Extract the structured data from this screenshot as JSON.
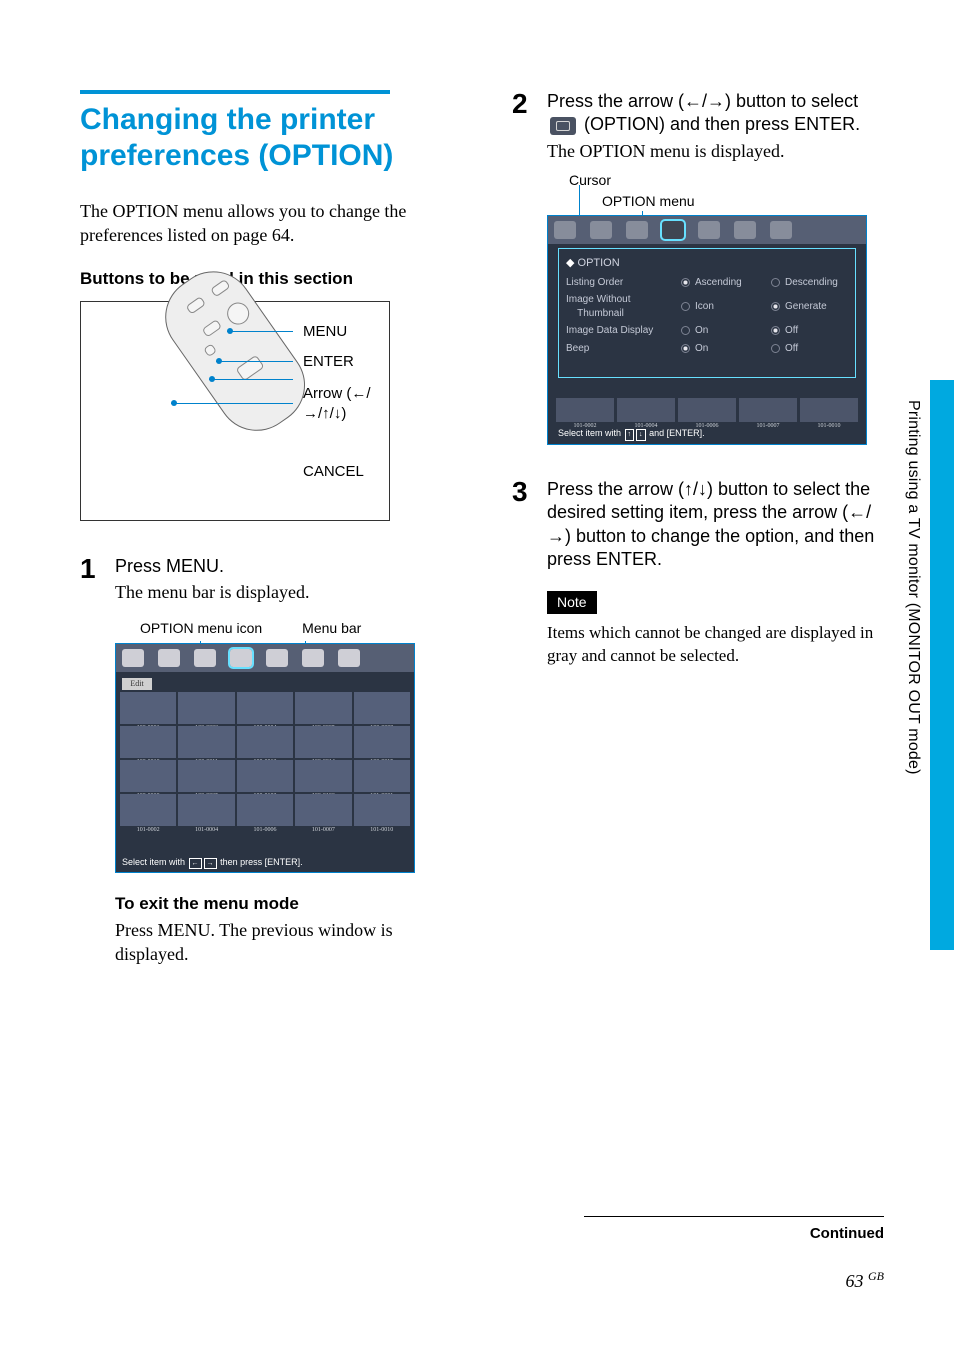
{
  "title": "Changing the printer preferences (OPTION)",
  "intro": "The OPTION menu allows you to change the preferences listed on page 64.",
  "buttons_heading": "Buttons to be used in this section",
  "remote_labels": {
    "menu": "MENU",
    "enter": "ENTER",
    "arrow": "Arrow (←/→/↑/↓)",
    "cancel": "CANCEL"
  },
  "step1": {
    "num": "1",
    "head": "Press MENU.",
    "desc": "The menu bar is displayed.",
    "label_icon": "OPTION menu icon",
    "label_bar": "Menu bar"
  },
  "screen1": {
    "edit": "Edit",
    "ids_row1": [
      "100-0001",
      "100-0003",
      "100-0004",
      "100-0005",
      "100-0008"
    ],
    "ids_row2": [
      "100-0010",
      "100-0011",
      "100-0012",
      "100-0014",
      "100-0015"
    ],
    "ids_row3": [
      "100-0030",
      "100-0035",
      "100-0102",
      "100-0103",
      "101-0001"
    ],
    "ids_row4": [
      "101-0002",
      "101-0004",
      "101-0006",
      "101-0007",
      "101-0010"
    ],
    "footer_a": "Select item with",
    "footer_b": "then press [ENTER]."
  },
  "exit_heading": "To exit the menu mode",
  "exit_text": "Press MENU.  The previous window is displayed.",
  "step2": {
    "num": "2",
    "head_a": "Press the arrow (←/→) button to select ",
    "head_b": " (OPTION) and then press ENTER.",
    "desc": "The OPTION  menu is displayed."
  },
  "cursor_label": "Cursor",
  "optmenu_label": "OPTION menu",
  "option_screen": {
    "title": "OPTION",
    "rows": [
      {
        "label": "Listing Order",
        "a": "Ascending",
        "b": "Descending",
        "sel": "a"
      },
      {
        "label": "Image Without",
        "label2": "Thumbnail",
        "a": "Icon",
        "b": "Generate",
        "sel": "b"
      },
      {
        "label": "Image Data Display",
        "a": "On",
        "b": "Off",
        "sel": "b"
      },
      {
        "label": "Beep",
        "a": "On",
        "b": "Off",
        "sel": "a"
      }
    ],
    "thumbs": [
      "101-0002",
      "101-0004",
      "101-0006",
      "101-0007",
      "101-0010"
    ],
    "footer_a": "Select item with",
    "footer_b": "and [ENTER]."
  },
  "step3": {
    "num": "3",
    "head": "Press the arrow (↑/↓) button to select the desired setting item, press the arrow (←/→) button to change the option, and then press ENTER."
  },
  "note_label": "Note",
  "note_text": "Items which cannot be changed are displayed in gray and cannot be selected.",
  "side_text": "Printing using a TV monitor (MONITOR OUT mode)",
  "continued": "Continued",
  "page": "63",
  "page_suffix": "GB"
}
